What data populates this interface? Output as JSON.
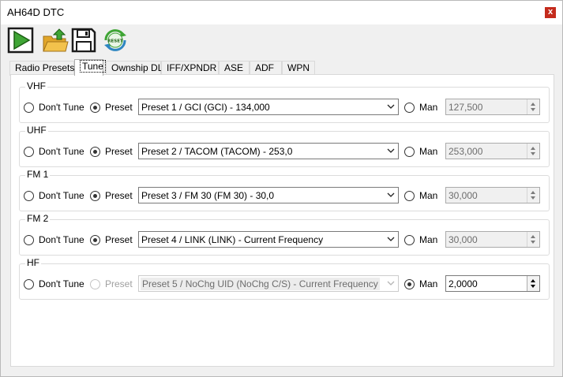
{
  "window": {
    "title": "AH64D DTC",
    "close_label": "x"
  },
  "toolbar": {
    "buttons": [
      {
        "name": "play-icon"
      },
      {
        "name": "open-folder-icon"
      },
      {
        "name": "save-icon"
      },
      {
        "name": "reset-icon",
        "label": "RESET"
      }
    ]
  },
  "tabs": [
    "Radio Presets",
    "Tune",
    "Ownship DL",
    "IFF/XPNDR",
    "ASE",
    "ADF",
    "WPN"
  ],
  "active_tab": "Tune",
  "labels": {
    "dont_tune": "Don't Tune",
    "preset": "Preset",
    "man": "Man"
  },
  "radios": [
    {
      "name": "VHF",
      "selection": "Preset",
      "preset_value": "Preset 1 / GCI (GCI) - 134,000",
      "preset_enabled": true,
      "man_value": "127,500",
      "man_enabled": false
    },
    {
      "name": "UHF",
      "selection": "Preset",
      "preset_value": "Preset 2 / TACOM (TACOM) - 253,0",
      "preset_enabled": true,
      "man_value": "253,000",
      "man_enabled": false
    },
    {
      "name": "FM 1",
      "selection": "Preset",
      "preset_value": "Preset 3 / FM 30 (FM 30) - 30,0",
      "preset_enabled": true,
      "man_value": "30,000",
      "man_enabled": false
    },
    {
      "name": "FM 2",
      "selection": "Preset",
      "preset_value": "Preset 4 / LINK (LINK) - Current Frequency",
      "preset_enabled": true,
      "man_value": "30,000",
      "man_enabled": false
    },
    {
      "name": "HF",
      "selection": "Man",
      "preset_value": "Preset 5 / NoChg UID (NoChg C/S) - Current Frequency",
      "preset_enabled": false,
      "man_value": "2,0000",
      "man_enabled": true
    }
  ]
}
